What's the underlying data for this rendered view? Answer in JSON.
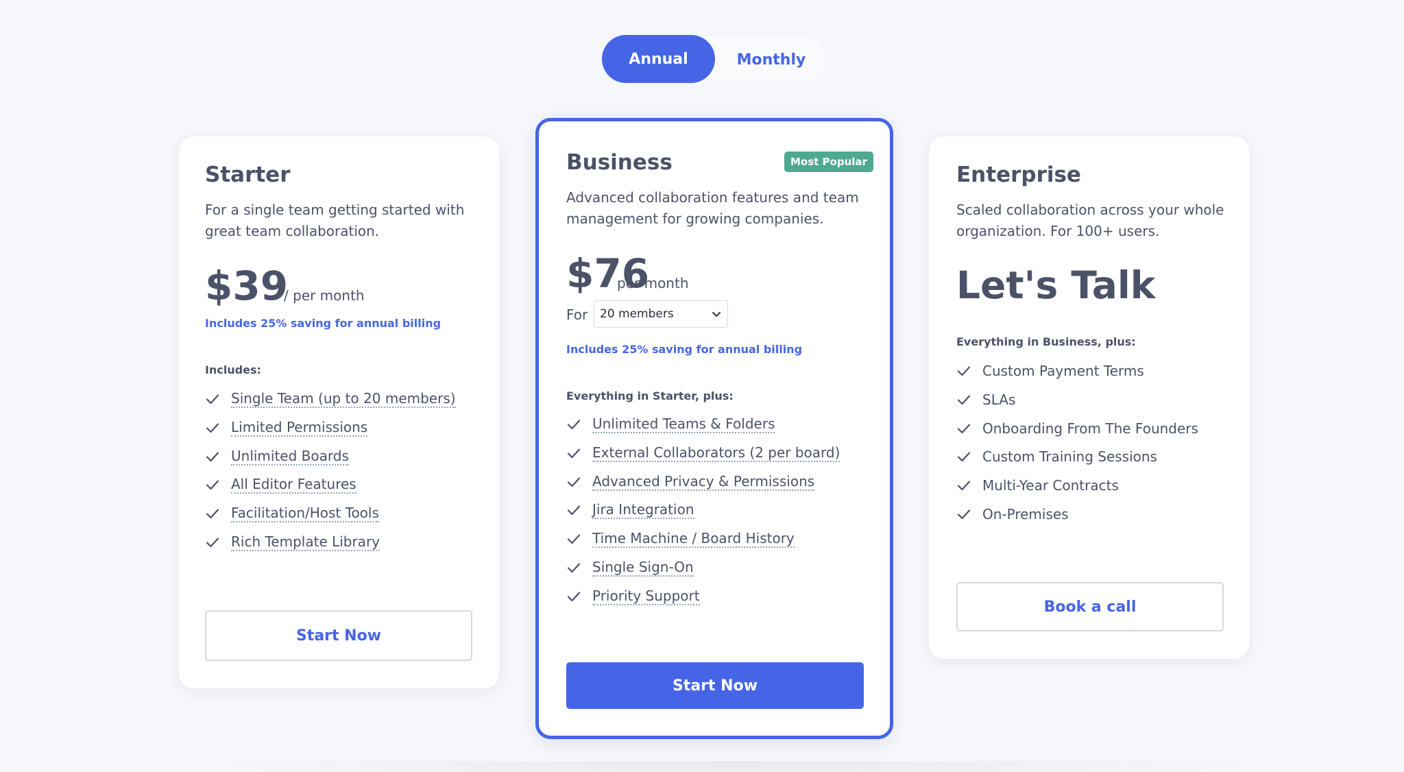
{
  "billing_toggle": {
    "annual_label": "Annual",
    "monthly_label": "Monthly",
    "selected": "Annual"
  },
  "colors": {
    "accent": "#4565e6",
    "badge": "#4fa892",
    "text": "#4b5268",
    "background": "#f5f7fb"
  },
  "plans": {
    "starter": {
      "name": "Starter",
      "description": "For a single team getting started with great team collaboration.",
      "price": "$39",
      "price_suffix": "/ per month",
      "saving_note": "Includes 25% saving for annual billing",
      "features_label": "Includes:",
      "features": [
        "Single Team (up to 20 members)",
        "Limited Permissions",
        "Unlimited Boards",
        "All Editor Features",
        "Facilitation/Host Tools",
        "Rich Template Library"
      ],
      "cta_label": "Start Now"
    },
    "business": {
      "name": "Business",
      "badge": "Most Popular",
      "description": "Advanced collaboration features and team management for growing companies.",
      "price": "$76",
      "price_suffix": "per month",
      "members_prefix": "For",
      "members_selected": "20 members",
      "saving_note": "Includes 25% saving for annual billing",
      "features_label": "Everything in Starter, plus:",
      "features": [
        "Unlimited Teams & Folders",
        "External Collaborators (2 per board)",
        "Advanced Privacy & Permissions",
        "Jira Integration",
        "Time Machine / Board History",
        "Single Sign-On",
        "Priority Support"
      ],
      "cta_label": "Start Now"
    },
    "enterprise": {
      "name": "Enterprise",
      "description": "Scaled collaboration across your whole organization. For 100+ users.",
      "price_text": "Let's Talk",
      "features_label": "Everything in Business, plus:",
      "features": [
        "Custom Payment Terms",
        "SLAs",
        "Onboarding From The Founders",
        "Custom Training Sessions",
        "Multi-Year Contracts",
        "On-Premises"
      ],
      "cta_label": "Book a call"
    }
  }
}
